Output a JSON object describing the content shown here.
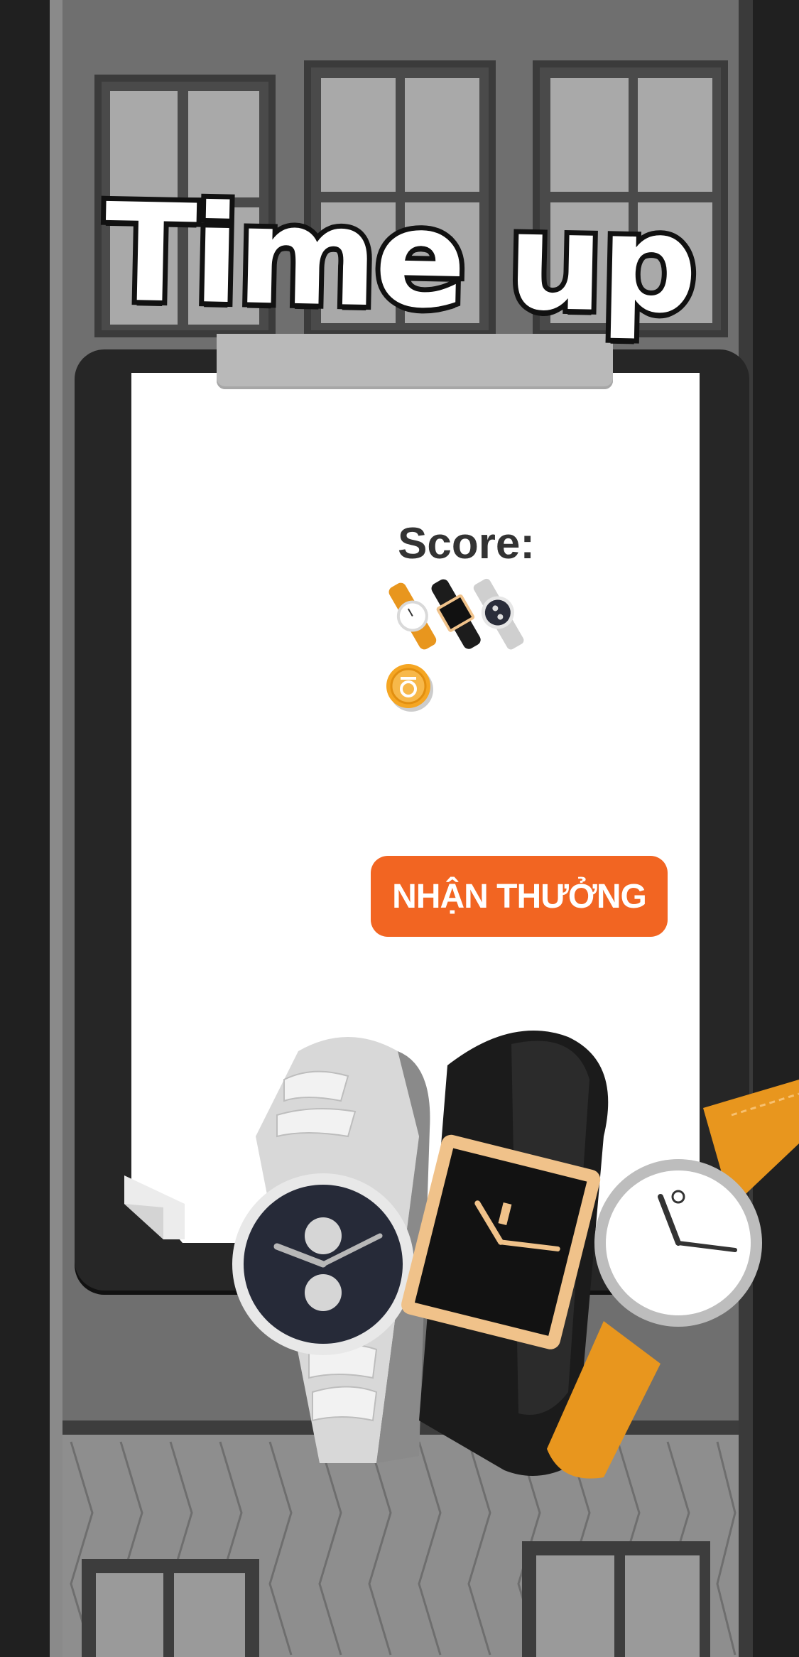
{
  "title": "Time up",
  "score": {
    "label": "Score:"
  },
  "reward_button": {
    "label": "NHẬN THƯỞNG"
  },
  "colors": {
    "accent": "#f26522",
    "strap_orange": "#e8961e",
    "gold": "#f0c28a",
    "coin": "#f5a623"
  },
  "icons": [
    "mini-watches-icon",
    "coin-icon",
    "watch-silver-icon",
    "watch-black-gold-icon",
    "watch-orange-icon"
  ]
}
